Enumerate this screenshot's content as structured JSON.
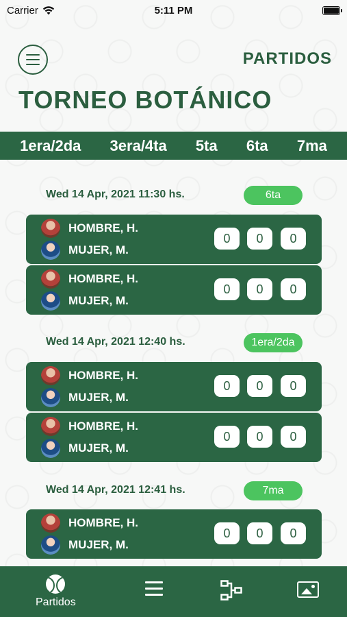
{
  "status": {
    "carrier": "Carrier",
    "time": "5:11 PM"
  },
  "header": {
    "nav_title": "PARTIDOS",
    "page_title": "TORNEO BOTÁNICO"
  },
  "categories": [
    "1era/2da",
    "3era/4ta",
    "5ta",
    "6ta",
    "7ma"
  ],
  "groups": [
    {
      "date": "Wed 14 Apr, 2021 11:30 hs.",
      "badge": "6ta",
      "matches": [
        {
          "player1": "HOMBRE, H.",
          "player2": "MUJER, M.",
          "scores": [
            "0",
            "0",
            "0"
          ]
        },
        {
          "player1": "HOMBRE, H.",
          "player2": "MUJER, M.",
          "scores": [
            "0",
            "0",
            "0"
          ]
        }
      ]
    },
    {
      "date": "Wed 14 Apr, 2021 12:40 hs.",
      "badge": "1era/2da",
      "matches": [
        {
          "player1": "HOMBRE, H.",
          "player2": "MUJER, M.",
          "scores": [
            "0",
            "0",
            "0"
          ]
        },
        {
          "player1": "HOMBRE, H.",
          "player2": "MUJER, M.",
          "scores": [
            "0",
            "0",
            "0"
          ]
        }
      ]
    },
    {
      "date": "Wed 14 Apr, 2021 12:41 hs.",
      "badge": "7ma",
      "matches": [
        {
          "player1": "HOMBRE, H.",
          "player2": "MUJER, M.",
          "scores": [
            "0",
            "0",
            "0"
          ]
        }
      ]
    }
  ],
  "tabbar": {
    "partidos_label": "Partidos"
  },
  "icons": {
    "menu": "hamburger-menu-icon",
    "partidos": "tennis-ball-icon",
    "list": "list-icon",
    "bracket": "bracket-icon",
    "gallery": "gallery-icon"
  },
  "colors": {
    "primary": "#2b6644",
    "accent": "#4cc45f",
    "text": "#2b5e3f"
  }
}
